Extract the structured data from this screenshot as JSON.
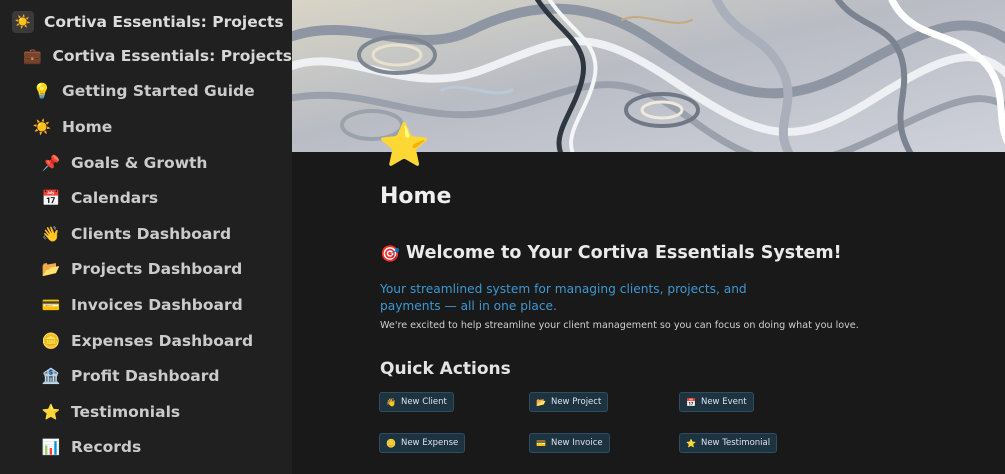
{
  "sidebar": {
    "workspace_icon": "sun-icon",
    "workspace_title": "Cortiva Essentials: Projects",
    "items": [
      {
        "label": "Cortiva Essentials: Projects",
        "icon": "briefcase-icon"
      },
      {
        "label": "Getting Started Guide",
        "icon": "lightbulb-icon"
      },
      {
        "label": "Home",
        "icon": "sun-icon"
      },
      {
        "label": "Goals & Growth",
        "icon": "pushpin-icon"
      },
      {
        "label": "Calendars",
        "icon": "calendar-icon"
      },
      {
        "label": "Clients Dashboard",
        "icon": "waving-hand-icon"
      },
      {
        "label": "Projects Dashboard",
        "icon": "folder-icon"
      },
      {
        "label": "Invoices Dashboard",
        "icon": "credit-card-icon"
      },
      {
        "label": "Expenses Dashboard",
        "icon": "coin-icon"
      },
      {
        "label": "Profit Dashboard",
        "icon": "bank-icon"
      },
      {
        "label": "Testimonials",
        "icon": "star-icon"
      },
      {
        "label": "Records",
        "icon": "bar-chart-icon"
      }
    ]
  },
  "page": {
    "icon": "star-icon",
    "title": "Home",
    "welcome_icon": "target-icon",
    "welcome_heading": "Welcome to Your Cortiva Essentials System!",
    "tagline": "Your streamlined system for managing clients, projects, and payments — all in one place.",
    "subtext": "We're excited to help streamline your client management so you can focus on doing what you love.",
    "quick_actions_heading": "Quick Actions",
    "quick_actions": [
      {
        "label": "New Client",
        "icon": "waving-hand-icon"
      },
      {
        "label": "New Project",
        "icon": "folder-icon"
      },
      {
        "label": "New Event",
        "icon": "calendar-icon"
      },
      {
        "label": "New Expense",
        "icon": "coin-icon"
      },
      {
        "label": "New Invoice",
        "icon": "credit-card-icon"
      },
      {
        "label": "New Testimonial",
        "icon": "star-icon"
      }
    ]
  },
  "colors": {
    "sidebar_bg": "#202020",
    "main_bg": "#191919",
    "accent_blue": "#3d98d3",
    "button_bg": "#1e3340"
  }
}
